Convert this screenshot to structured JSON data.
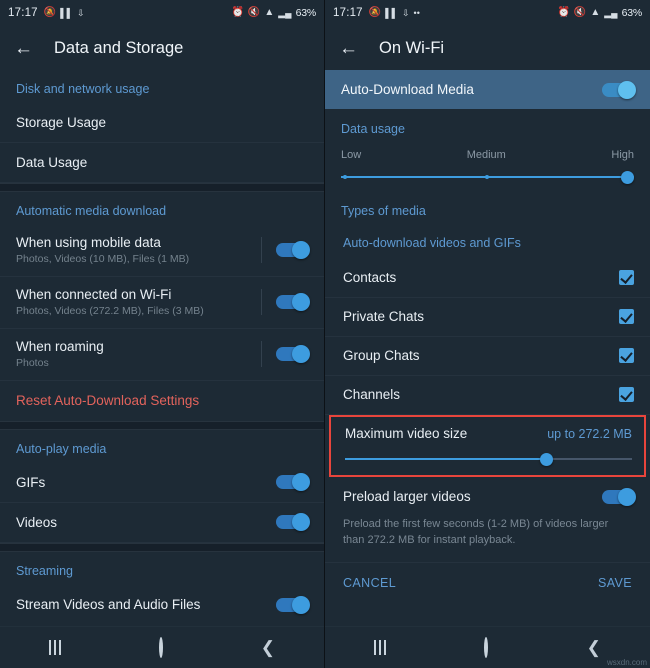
{
  "left": {
    "status": {
      "clock": "17:17",
      "battery": "63%",
      "icons": [
        "bell-mute-icon",
        "signal-bars-icon",
        "download-icon"
      ],
      "right_icons": [
        "alarm-icon",
        "mute-icon",
        "wifi-icon",
        "signal-icon"
      ]
    },
    "appbar": {
      "back": "←",
      "title": "Data and Storage"
    },
    "sections": [
      {
        "header": "Disk and network usage",
        "rows": [
          {
            "t1": "Storage Usage",
            "t2": ""
          },
          {
            "t1": "Data Usage",
            "t2": ""
          }
        ]
      },
      {
        "header": "Automatic media download",
        "rows": [
          {
            "t1": "When using mobile data",
            "t2": "Photos, Videos (10 MB), Files (1 MB)",
            "toggle": true
          },
          {
            "t1": "When connected on Wi-Fi",
            "t2": "Photos, Videos (272.2 MB), Files (3 MB)",
            "toggle": true
          },
          {
            "t1": "When roaming",
            "t2": "Photos",
            "toggle": true
          },
          {
            "t1": "Reset Auto-Download Settings",
            "t2": "",
            "danger": true
          }
        ]
      },
      {
        "header": "Auto-play media",
        "rows": [
          {
            "t1": "GIFs",
            "t2": "",
            "toggle": true
          },
          {
            "t1": "Videos",
            "t2": "",
            "toggle": true
          }
        ]
      },
      {
        "header": "Streaming",
        "rows": [
          {
            "t1": "Stream Videos and Audio Files",
            "t2": "",
            "toggle": true
          }
        ]
      }
    ]
  },
  "right": {
    "status": {
      "clock": "17:17",
      "battery": "63%"
    },
    "appbar": {
      "back": "←",
      "title": "On Wi-Fi"
    },
    "auto_download": {
      "label": "Auto-Download Media",
      "enabled": true
    },
    "data_usage": {
      "header": "Data usage",
      "ticks": [
        "Low",
        "Medium",
        "High"
      ],
      "value": "High",
      "position_pct": 100
    },
    "types_of_media": "Types of media",
    "panel": {
      "header": "Auto-download videos and GIFs",
      "checks": [
        {
          "label": "Contacts",
          "checked": true
        },
        {
          "label": "Private Chats",
          "checked": true
        },
        {
          "label": "Group Chats",
          "checked": true
        },
        {
          "label": "Channels",
          "checked": true
        }
      ],
      "max_video": {
        "label": "Maximum video size",
        "value": "up to 272.2 MB",
        "slider_pct": 71,
        "highlighted": true
      },
      "preload": {
        "label": "Preload larger videos",
        "enabled": true
      },
      "note": "Preload the first few seconds (1-2 MB) of videos larger than 272.2 MB for instant playback.",
      "cancel": "CANCEL",
      "save": "SAVE"
    }
  },
  "navbar": {
    "recents": "recents-icon",
    "home": "home-icon",
    "back": "back-icon"
  },
  "watermark": "wsxdn.com",
  "colors": {
    "accent": "#5e9ad2",
    "toggle_on": "#3d9cdf",
    "danger": "#e2635c",
    "highlight": "#e8453c",
    "band": "#3e6486",
    "bg": "#1d2a35"
  }
}
